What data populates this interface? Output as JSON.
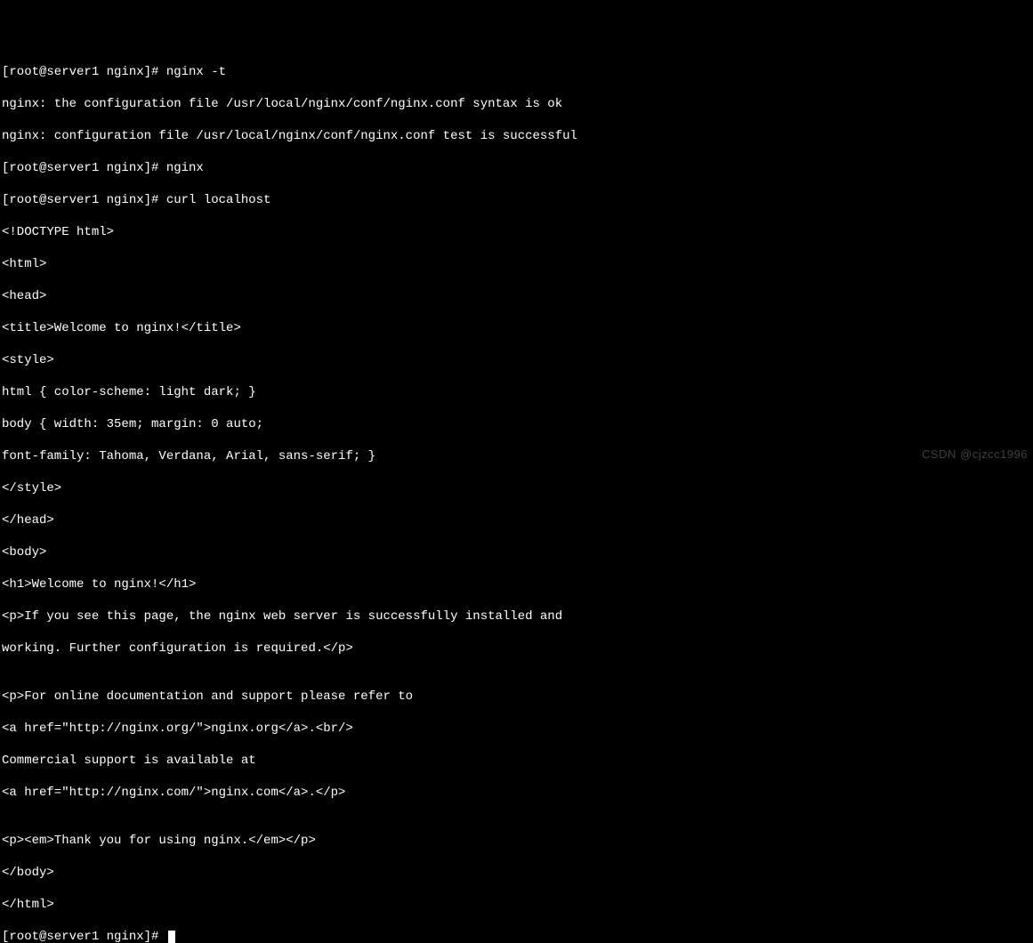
{
  "terminal": {
    "lines": {
      "l0": "[root@server1 nginx]# nginx -t",
      "l1": "nginx: the configuration file /usr/local/nginx/conf/nginx.conf syntax is ok",
      "l2": "nginx: configuration file /usr/local/nginx/conf/nginx.conf test is successful",
      "l3": "[root@server1 nginx]# nginx",
      "l4": "[root@server1 nginx]# curl localhost",
      "l5": "<!DOCTYPE html>",
      "l6": "<html>",
      "l7": "<head>",
      "l8": "<title>Welcome to nginx!</title>",
      "l9": "<style>",
      "l10": "html { color-scheme: light dark; }",
      "l11": "body { width: 35em; margin: 0 auto;",
      "l12": "font-family: Tahoma, Verdana, Arial, sans-serif; }",
      "l13": "</style>",
      "l14": "</head>",
      "l15": "<body>",
      "l16": "<h1>Welcome to nginx!</h1>",
      "l17": "<p>If you see this page, the nginx web server is successfully installed and",
      "l18": "working. Further configuration is required.</p>",
      "l19": "",
      "l20": "<p>For online documentation and support please refer to",
      "l21": "<a href=\"http://nginx.org/\">nginx.org</a>.<br/>",
      "l22": "Commercial support is available at",
      "l23": "<a href=\"http://nginx.com/\">nginx.com</a>.</p>",
      "l24": "",
      "l25": "<p><em>Thank you for using nginx.</em></p>",
      "l26": "</body>",
      "l27": "</html>",
      "l28": "[root@server1 nginx]# "
    }
  },
  "watermark": "CSDN @cjzcc1996"
}
